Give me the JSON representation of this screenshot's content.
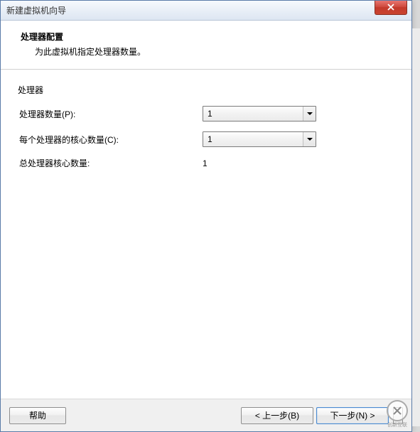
{
  "window": {
    "title": "新建虚拟机向导"
  },
  "header": {
    "title": "处理器配置",
    "subtitle": "为此虚拟机指定处理器数量。"
  },
  "group": {
    "label": "处理器"
  },
  "fields": {
    "proc_count": {
      "label": "处理器数量(P):",
      "value": "1"
    },
    "cores_per": {
      "label": "每个处理器的核心数量(C):",
      "value": "1"
    },
    "total": {
      "label": "总处理器核心数量:",
      "value": "1"
    }
  },
  "footer": {
    "help": "帮助",
    "back": "< 上一步(B)",
    "next": "下一步(N) >"
  },
  "watermark": {
    "text": "创新互联"
  }
}
